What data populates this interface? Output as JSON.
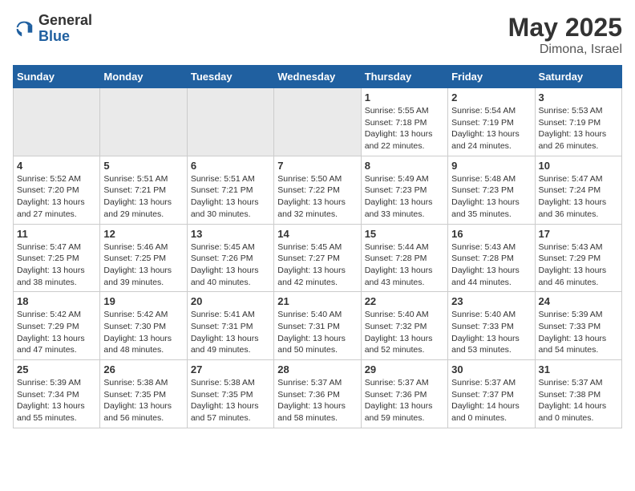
{
  "header": {
    "logo_general": "General",
    "logo_blue": "Blue",
    "month_year": "May 2025",
    "location": "Dimona, Israel"
  },
  "days_of_week": [
    "Sunday",
    "Monday",
    "Tuesday",
    "Wednesday",
    "Thursday",
    "Friday",
    "Saturday"
  ],
  "weeks": [
    [
      {
        "num": "",
        "info": ""
      },
      {
        "num": "",
        "info": ""
      },
      {
        "num": "",
        "info": ""
      },
      {
        "num": "",
        "info": ""
      },
      {
        "num": "1",
        "info": "Sunrise: 5:55 AM\nSunset: 7:18 PM\nDaylight: 13 hours\nand 22 minutes."
      },
      {
        "num": "2",
        "info": "Sunrise: 5:54 AM\nSunset: 7:19 PM\nDaylight: 13 hours\nand 24 minutes."
      },
      {
        "num": "3",
        "info": "Sunrise: 5:53 AM\nSunset: 7:19 PM\nDaylight: 13 hours\nand 26 minutes."
      }
    ],
    [
      {
        "num": "4",
        "info": "Sunrise: 5:52 AM\nSunset: 7:20 PM\nDaylight: 13 hours\nand 27 minutes."
      },
      {
        "num": "5",
        "info": "Sunrise: 5:51 AM\nSunset: 7:21 PM\nDaylight: 13 hours\nand 29 minutes."
      },
      {
        "num": "6",
        "info": "Sunrise: 5:51 AM\nSunset: 7:21 PM\nDaylight: 13 hours\nand 30 minutes."
      },
      {
        "num": "7",
        "info": "Sunrise: 5:50 AM\nSunset: 7:22 PM\nDaylight: 13 hours\nand 32 minutes."
      },
      {
        "num": "8",
        "info": "Sunrise: 5:49 AM\nSunset: 7:23 PM\nDaylight: 13 hours\nand 33 minutes."
      },
      {
        "num": "9",
        "info": "Sunrise: 5:48 AM\nSunset: 7:23 PM\nDaylight: 13 hours\nand 35 minutes."
      },
      {
        "num": "10",
        "info": "Sunrise: 5:47 AM\nSunset: 7:24 PM\nDaylight: 13 hours\nand 36 minutes."
      }
    ],
    [
      {
        "num": "11",
        "info": "Sunrise: 5:47 AM\nSunset: 7:25 PM\nDaylight: 13 hours\nand 38 minutes."
      },
      {
        "num": "12",
        "info": "Sunrise: 5:46 AM\nSunset: 7:25 PM\nDaylight: 13 hours\nand 39 minutes."
      },
      {
        "num": "13",
        "info": "Sunrise: 5:45 AM\nSunset: 7:26 PM\nDaylight: 13 hours\nand 40 minutes."
      },
      {
        "num": "14",
        "info": "Sunrise: 5:45 AM\nSunset: 7:27 PM\nDaylight: 13 hours\nand 42 minutes."
      },
      {
        "num": "15",
        "info": "Sunrise: 5:44 AM\nSunset: 7:28 PM\nDaylight: 13 hours\nand 43 minutes."
      },
      {
        "num": "16",
        "info": "Sunrise: 5:43 AM\nSunset: 7:28 PM\nDaylight: 13 hours\nand 44 minutes."
      },
      {
        "num": "17",
        "info": "Sunrise: 5:43 AM\nSunset: 7:29 PM\nDaylight: 13 hours\nand 46 minutes."
      }
    ],
    [
      {
        "num": "18",
        "info": "Sunrise: 5:42 AM\nSunset: 7:29 PM\nDaylight: 13 hours\nand 47 minutes."
      },
      {
        "num": "19",
        "info": "Sunrise: 5:42 AM\nSunset: 7:30 PM\nDaylight: 13 hours\nand 48 minutes."
      },
      {
        "num": "20",
        "info": "Sunrise: 5:41 AM\nSunset: 7:31 PM\nDaylight: 13 hours\nand 49 minutes."
      },
      {
        "num": "21",
        "info": "Sunrise: 5:40 AM\nSunset: 7:31 PM\nDaylight: 13 hours\nand 50 minutes."
      },
      {
        "num": "22",
        "info": "Sunrise: 5:40 AM\nSunset: 7:32 PM\nDaylight: 13 hours\nand 52 minutes."
      },
      {
        "num": "23",
        "info": "Sunrise: 5:40 AM\nSunset: 7:33 PM\nDaylight: 13 hours\nand 53 minutes."
      },
      {
        "num": "24",
        "info": "Sunrise: 5:39 AM\nSunset: 7:33 PM\nDaylight: 13 hours\nand 54 minutes."
      }
    ],
    [
      {
        "num": "25",
        "info": "Sunrise: 5:39 AM\nSunset: 7:34 PM\nDaylight: 13 hours\nand 55 minutes."
      },
      {
        "num": "26",
        "info": "Sunrise: 5:38 AM\nSunset: 7:35 PM\nDaylight: 13 hours\nand 56 minutes."
      },
      {
        "num": "27",
        "info": "Sunrise: 5:38 AM\nSunset: 7:35 PM\nDaylight: 13 hours\nand 57 minutes."
      },
      {
        "num": "28",
        "info": "Sunrise: 5:37 AM\nSunset: 7:36 PM\nDaylight: 13 hours\nand 58 minutes."
      },
      {
        "num": "29",
        "info": "Sunrise: 5:37 AM\nSunset: 7:36 PM\nDaylight: 13 hours\nand 59 minutes."
      },
      {
        "num": "30",
        "info": "Sunrise: 5:37 AM\nSunset: 7:37 PM\nDaylight: 14 hours\nand 0 minutes."
      },
      {
        "num": "31",
        "info": "Sunrise: 5:37 AM\nSunset: 7:38 PM\nDaylight: 14 hours\nand 0 minutes."
      }
    ]
  ]
}
